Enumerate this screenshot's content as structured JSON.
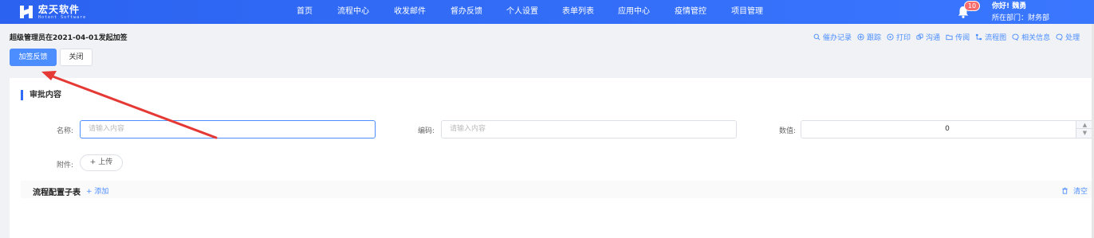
{
  "app": {
    "logo_cn": "宏天软件",
    "logo_en": "Hotent Software"
  },
  "nav": {
    "items": [
      "首页",
      "流程中心",
      "收发邮件",
      "督办反馈",
      "个人设置",
      "表单列表",
      "应用中心",
      "疫情管控",
      "项目管理"
    ]
  },
  "notifications": {
    "count": "10",
    "icon": "bell-icon"
  },
  "user": {
    "greeting": "你好! 魏勇",
    "department": "所在部门：财务部"
  },
  "page": {
    "title": "超级管理员在2021-04-01发起加签",
    "primary_button": "加签反馈",
    "close_button": "关闭"
  },
  "toolbar": {
    "items": [
      {
        "label": "催办记录",
        "icon": "search-icon"
      },
      {
        "label": "跟踪",
        "icon": "track-icon"
      },
      {
        "label": "打印",
        "icon": "print-icon"
      },
      {
        "label": "沟通",
        "icon": "link-icon"
      },
      {
        "label": "传阅",
        "icon": "folder-icon"
      },
      {
        "label": "流程图",
        "icon": "flowchart-icon"
      },
      {
        "label": "相关信息",
        "icon": "chat-icon"
      },
      {
        "label": "处理",
        "icon": "chat-icon"
      }
    ]
  },
  "form": {
    "section_title": "审批内容",
    "name_label": "名称:",
    "name_placeholder": "请输入内容",
    "code_label": "编码:",
    "code_placeholder": "请输入内容",
    "value_label": "数值:",
    "value": "0",
    "attachment_label": "附件:",
    "upload_label": "+ 上传"
  },
  "subtable": {
    "title": "流程配置子表",
    "add_label": "+ 添加",
    "clear_label": "清空"
  },
  "colors": {
    "brand": "#2f6bff",
    "primary_button": "#4c8dff",
    "badge": "#f56c6c",
    "annotation_arrow": "#e53935"
  }
}
